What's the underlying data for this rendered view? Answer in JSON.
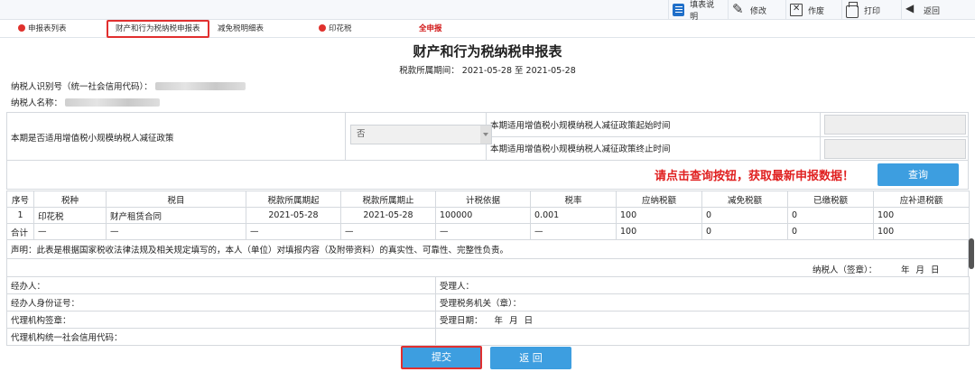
{
  "toolbar": {
    "items": [
      {
        "label": "填表说明",
        "icon": "document-icon"
      },
      {
        "label": "修改",
        "icon": "pen-icon"
      },
      {
        "label": "作废",
        "icon": "void-icon"
      },
      {
        "label": "打印",
        "icon": "printer-icon"
      },
      {
        "label": "返回",
        "icon": "back-arrow-icon"
      }
    ]
  },
  "tabs": [
    {
      "label": "申报表列表",
      "has_dot": true
    },
    {
      "label": "财产和行为税纳税申报表",
      "active": true
    },
    {
      "label": "减免税明细表"
    },
    {
      "label": "印花税",
      "has_dot": true
    },
    {
      "label": "全申报",
      "red": true
    }
  ],
  "form": {
    "title": "财产和行为税纳税申报表",
    "period_label": "税款所属期间：",
    "period_value": "2021-05-28 至 2021-05-28",
    "taxpayer_id_label": "纳税人识别号（统一社会信用代码）：",
    "taxpayer_name_label": "纳税人名称："
  },
  "policy": {
    "question": "本期是否适用增值税小规模纳税人减征政策",
    "select_value": "否",
    "start_label": "本期适用增值税小规模纳税人减征政策起始时间",
    "end_label": "本期适用增值税小规模纳税人减征政策终止时间"
  },
  "query": {
    "notice": "请点击查询按钮，获取最新申报数据！",
    "button": "查询"
  },
  "table": {
    "headers": [
      "序号",
      "税种",
      "税目",
      "税款所属期起",
      "税款所属期止",
      "计税依据",
      "税率",
      "应纳税额",
      "减免税额",
      "已缴税额",
      "应补退税额"
    ],
    "row": [
      "1",
      "印花税",
      "财产租赁合同",
      "2021-05-28",
      "2021-05-28",
      "100000",
      "0.001",
      "100",
      "0",
      "0",
      "100"
    ],
    "total": [
      "合计",
      "—",
      "—",
      "—",
      "—",
      "—",
      "—",
      "100",
      "0",
      "0",
      "100"
    ]
  },
  "declaration": "声明：此表是根据国家税收法律法规及相关规定填写的，本人（单位）对填报内容（及附带资料）的真实性、可靠性、完整性负责。",
  "signature": {
    "label": "纳税人（签章）：",
    "date": "年 月 日"
  },
  "footer": {
    "agent": "经办人：",
    "agent_id": "经办人身份证号：",
    "agency_seal": "代理机构签章：",
    "agency_code": "代理机构统一社会信用代码：",
    "receiver": "受理人：",
    "receiving_office": "受理税务机关（章）：",
    "receive_date_label": "受理日期：",
    "receive_date_value": "年 月 日"
  },
  "buttons": {
    "submit": "提交",
    "back": "返 回"
  }
}
